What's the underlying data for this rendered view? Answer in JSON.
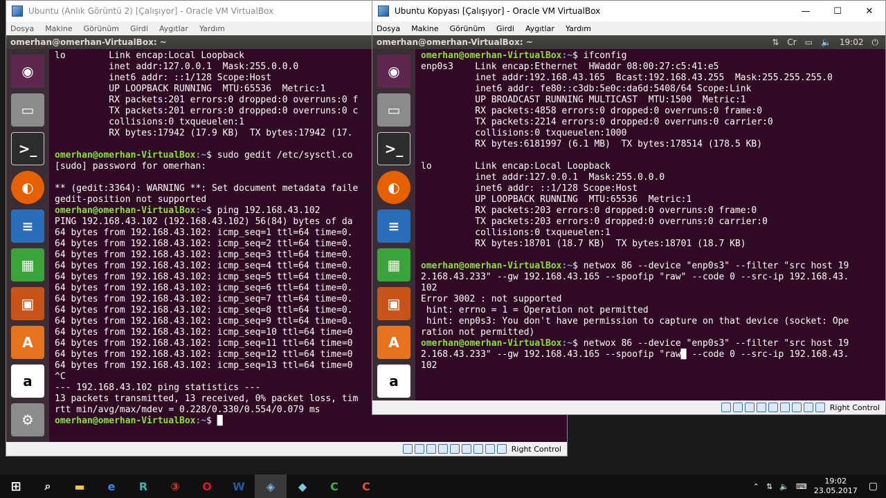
{
  "window_left": {
    "title": "Ubuntu (Anlık Görüntü 2) [Çalışıyor] - Oracle VM VirtualBox",
    "menu": [
      "Dosya",
      "Makine",
      "Görünüm",
      "Girdi",
      "Aygıtlar",
      "Yardım"
    ],
    "guest_title": "omerhan@omerhan-VirtualBox: ~",
    "status_text": "Right Control",
    "lines": [
      {
        "t": "lo        Link encap:Local Loopback"
      },
      {
        "t": "          inet addr:127.0.0.1  Mask:255.0.0.0"
      },
      {
        "t": "          inet6 addr: ::1/128 Scope:Host"
      },
      {
        "t": "          UP LOOPBACK RUNNING  MTU:65536  Metric:1"
      },
      {
        "t": "          RX packets:201 errors:0 dropped:0 overruns:0 f"
      },
      {
        "t": "          TX packets:201 errors:0 dropped:0 overruns:0 c"
      },
      {
        "t": "          collisions:0 txqueuelen:1"
      },
      {
        "t": "          RX bytes:17942 (17.9 KB)  TX bytes:17942 (17."
      },
      {
        "t": ""
      },
      {
        "p": "omerhan@omerhan-VirtualBox",
        "d": "~",
        "t": "$ sudo gedit /etc/sysctl.co"
      },
      {
        "t": "[sudo] password for omerhan:"
      },
      {
        "t": ""
      },
      {
        "t": "** (gedit:3364): WARNING **: Set document metadata faile"
      },
      {
        "t": "gedit-position not supported"
      },
      {
        "p": "omerhan@omerhan-VirtualBox",
        "d": "~",
        "t": "$ ping 192.168.43.102"
      },
      {
        "t": "PING 192.168.43.102 (192.168.43.102) 56(84) bytes of da"
      },
      {
        "t": "64 bytes from 192.168.43.102: icmp_seq=1 ttl=64 time=0."
      },
      {
        "t": "64 bytes from 192.168.43.102: icmp_seq=2 ttl=64 time=0."
      },
      {
        "t": "64 bytes from 192.168.43.102: icmp_seq=3 ttl=64 time=0."
      },
      {
        "t": "64 bytes from 192.168.43.102: icmp_seq=4 ttl=64 time=0."
      },
      {
        "t": "64 bytes from 192.168.43.102: icmp_seq=5 ttl=64 time=0."
      },
      {
        "t": "64 bytes from 192.168.43.102: icmp_seq=6 ttl=64 time=0."
      },
      {
        "t": "64 bytes from 192.168.43.102: icmp_seq=7 ttl=64 time=0."
      },
      {
        "t": "64 bytes from 192.168.43.102: icmp_seq=8 ttl=64 time=0."
      },
      {
        "t": "64 bytes from 192.168.43.102: icmp_seq=9 ttl=64 time=0."
      },
      {
        "t": "64 bytes from 192.168.43.102: icmp_seq=10 ttl=64 time=0"
      },
      {
        "t": "64 bytes from 192.168.43.102: icmp_seq=11 ttl=64 time=0"
      },
      {
        "t": "64 bytes from 192.168.43.102: icmp_seq=12 ttl=64 time=0"
      },
      {
        "t": "64 bytes from 192.168.43.102: icmp_seq=13 ttl=64 time=0"
      },
      {
        "t": "^C"
      },
      {
        "t": "--- 192.168.43.102 ping statistics ---"
      },
      {
        "t": "13 packets transmitted, 13 received, 0% packet loss, tim"
      },
      {
        "t": "rtt min/avg/max/mdev = 0.228/0.330/0.554/0.079 ms"
      },
      {
        "p": "omerhan@omerhan-VirtualBox",
        "d": "~",
        "t": "$ █"
      }
    ]
  },
  "window_right": {
    "title": "Ubuntu Kopyası [Çalışıyor] - Oracle VM VirtualBox",
    "menu": [
      "Dosya",
      "Makine",
      "Görünüm",
      "Girdi",
      "Aygıtlar",
      "Yardım"
    ],
    "guest_title": "omerhan@omerhan-VirtualBox: ~",
    "guest_clock": "19:02",
    "status_text": "Right Control",
    "lines": [
      {
        "p": "omerhan@omerhan-VirtualBox",
        "d": "~",
        "t": "$ ifconfig"
      },
      {
        "t": "enp0s3    Link encap:Ethernet  HWaddr 08:00:27:c5:41:e5"
      },
      {
        "t": "          inet addr:192.168.43.165  Bcast:192.168.43.255  Mask:255.255.255.0"
      },
      {
        "t": "          inet6 addr: fe80::c3db:5e0c:da6d:5408/64 Scope:Link"
      },
      {
        "t": "          UP BROADCAST RUNNING MULTICAST  MTU:1500  Metric:1"
      },
      {
        "t": "          RX packets:4858 errors:0 dropped:0 overruns:0 frame:0"
      },
      {
        "t": "          TX packets:2214 errors:0 dropped:0 overruns:0 carrier:0"
      },
      {
        "t": "          collisions:0 txqueuelen:1000"
      },
      {
        "t": "          RX bytes:6181997 (6.1 MB)  TX bytes:178514 (178.5 KB)"
      },
      {
        "t": ""
      },
      {
        "t": "lo        Link encap:Local Loopback"
      },
      {
        "t": "          inet addr:127.0.0.1  Mask:255.0.0.0"
      },
      {
        "t": "          inet6 addr: ::1/128 Scope:Host"
      },
      {
        "t": "          UP LOOPBACK RUNNING  MTU:65536  Metric:1"
      },
      {
        "t": "          RX packets:203 errors:0 dropped:0 overruns:0 frame:0"
      },
      {
        "t": "          TX packets:203 errors:0 dropped:0 overruns:0 carrier:0"
      },
      {
        "t": "          collisions:0 txqueuelen:1"
      },
      {
        "t": "          RX bytes:18701 (18.7 KB)  TX bytes:18701 (18.7 KB)"
      },
      {
        "t": ""
      },
      {
        "p": "omerhan@omerhan-VirtualBox",
        "d": "~",
        "t": "$ netwox 86 --device \"enp0s3\" --filter \"src host 19"
      },
      {
        "t": "2.168.43.233\" --gw 192.168.43.165 --spoofip \"raw\" --code 0 --src-ip 192.168.43."
      },
      {
        "t": "102"
      },
      {
        "t": "Error 3002 : not supported"
      },
      {
        "t": " hint: errno = 1 = Operation not permitted"
      },
      {
        "t": " hint: enp0s3: You don't have permission to capture on that device (socket: Ope"
      },
      {
        "t": "ration not permitted)"
      },
      {
        "p": "omerhan@omerhan-VirtualBox",
        "d": "~",
        "t": "$ netwox 86 --device \"enp0s3\" --filter \"src host 19"
      },
      {
        "t": "2.168.43.233\" --gw 192.168.43.165 --spoofip \"raw█ --code 0 --src-ip 192.168.43."
      },
      {
        "t": "102"
      }
    ]
  },
  "taskbar": {
    "time": "19:02",
    "date": "23.05.2017"
  },
  "colors": {
    "terminal_bg": "#300a24",
    "prompt": "#8ae234",
    "path": "#729fcf"
  }
}
